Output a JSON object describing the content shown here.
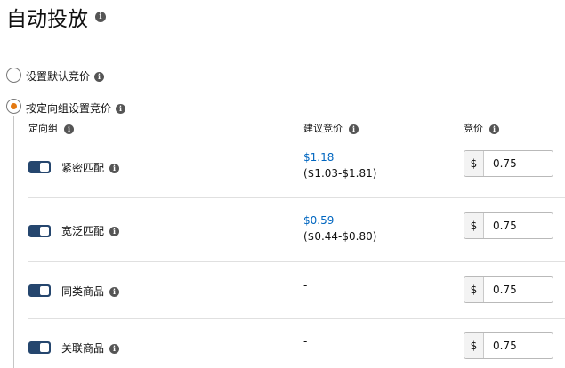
{
  "page": {
    "title": "自动投放"
  },
  "options": {
    "default_bid": "设置默认竞价",
    "targeting_group_bid": "按定向组设置竞价"
  },
  "table": {
    "headers": {
      "targeting_group": "定向组",
      "suggested_bid": "建议竞价",
      "bid": "竞价"
    },
    "rows": [
      {
        "name": "紧密匹配",
        "enabled": true,
        "suggested": "$1.18",
        "range": "($1.03-$1.81)",
        "currency": "$",
        "bid": "0.75"
      },
      {
        "name": "宽泛匹配",
        "enabled": true,
        "suggested": "$0.59",
        "range": "($0.44-$0.80)",
        "currency": "$",
        "bid": "0.75"
      },
      {
        "name": "同类商品",
        "enabled": true,
        "suggested": "-",
        "currency": "$",
        "bid": "0.75"
      },
      {
        "name": "关联商品",
        "enabled": true,
        "suggested": "-",
        "currency": "$",
        "bid": "0.75"
      }
    ]
  },
  "colors": {
    "toggle_on": "#25466e",
    "radio_selected": "#e47911",
    "link_blue": "#0066c0"
  },
  "icons": {
    "info": "info-icon"
  }
}
